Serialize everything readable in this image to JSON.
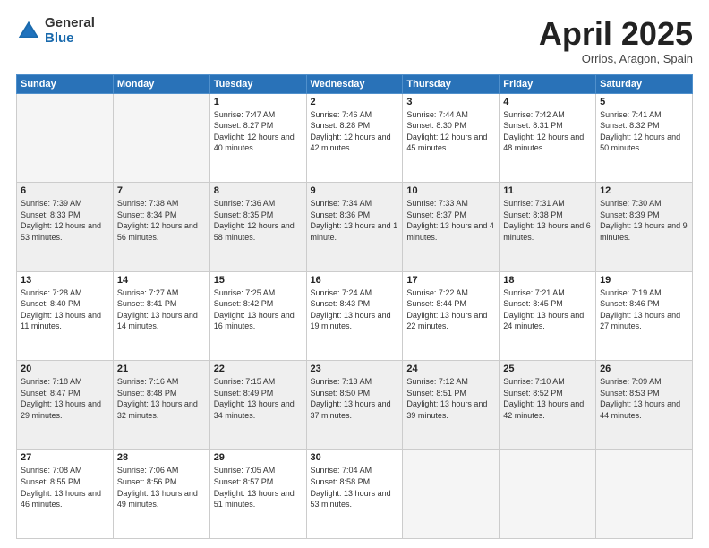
{
  "header": {
    "logo_general": "General",
    "logo_blue": "Blue",
    "month": "April 2025",
    "location": "Orrios, Aragon, Spain"
  },
  "days_of_week": [
    "Sunday",
    "Monday",
    "Tuesday",
    "Wednesday",
    "Thursday",
    "Friday",
    "Saturday"
  ],
  "weeks": [
    [
      {
        "num": "",
        "empty": true
      },
      {
        "num": "",
        "empty": true
      },
      {
        "num": "1",
        "sunrise": "7:47 AM",
        "sunset": "8:27 PM",
        "daylight": "12 hours and 40 minutes."
      },
      {
        "num": "2",
        "sunrise": "7:46 AM",
        "sunset": "8:28 PM",
        "daylight": "12 hours and 42 minutes."
      },
      {
        "num": "3",
        "sunrise": "7:44 AM",
        "sunset": "8:30 PM",
        "daylight": "12 hours and 45 minutes."
      },
      {
        "num": "4",
        "sunrise": "7:42 AM",
        "sunset": "8:31 PM",
        "daylight": "12 hours and 48 minutes."
      },
      {
        "num": "5",
        "sunrise": "7:41 AM",
        "sunset": "8:32 PM",
        "daylight": "12 hours and 50 minutes."
      }
    ],
    [
      {
        "num": "6",
        "sunrise": "7:39 AM",
        "sunset": "8:33 PM",
        "daylight": "12 hours and 53 minutes."
      },
      {
        "num": "7",
        "sunrise": "7:38 AM",
        "sunset": "8:34 PM",
        "daylight": "12 hours and 56 minutes."
      },
      {
        "num": "8",
        "sunrise": "7:36 AM",
        "sunset": "8:35 PM",
        "daylight": "12 hours and 58 minutes."
      },
      {
        "num": "9",
        "sunrise": "7:34 AM",
        "sunset": "8:36 PM",
        "daylight": "13 hours and 1 minute."
      },
      {
        "num": "10",
        "sunrise": "7:33 AM",
        "sunset": "8:37 PM",
        "daylight": "13 hours and 4 minutes."
      },
      {
        "num": "11",
        "sunrise": "7:31 AM",
        "sunset": "8:38 PM",
        "daylight": "13 hours and 6 minutes."
      },
      {
        "num": "12",
        "sunrise": "7:30 AM",
        "sunset": "8:39 PM",
        "daylight": "13 hours and 9 minutes."
      }
    ],
    [
      {
        "num": "13",
        "sunrise": "7:28 AM",
        "sunset": "8:40 PM",
        "daylight": "13 hours and 11 minutes."
      },
      {
        "num": "14",
        "sunrise": "7:27 AM",
        "sunset": "8:41 PM",
        "daylight": "13 hours and 14 minutes."
      },
      {
        "num": "15",
        "sunrise": "7:25 AM",
        "sunset": "8:42 PM",
        "daylight": "13 hours and 16 minutes."
      },
      {
        "num": "16",
        "sunrise": "7:24 AM",
        "sunset": "8:43 PM",
        "daylight": "13 hours and 19 minutes."
      },
      {
        "num": "17",
        "sunrise": "7:22 AM",
        "sunset": "8:44 PM",
        "daylight": "13 hours and 22 minutes."
      },
      {
        "num": "18",
        "sunrise": "7:21 AM",
        "sunset": "8:45 PM",
        "daylight": "13 hours and 24 minutes."
      },
      {
        "num": "19",
        "sunrise": "7:19 AM",
        "sunset": "8:46 PM",
        "daylight": "13 hours and 27 minutes."
      }
    ],
    [
      {
        "num": "20",
        "sunrise": "7:18 AM",
        "sunset": "8:47 PM",
        "daylight": "13 hours and 29 minutes."
      },
      {
        "num": "21",
        "sunrise": "7:16 AM",
        "sunset": "8:48 PM",
        "daylight": "13 hours and 32 minutes."
      },
      {
        "num": "22",
        "sunrise": "7:15 AM",
        "sunset": "8:49 PM",
        "daylight": "13 hours and 34 minutes."
      },
      {
        "num": "23",
        "sunrise": "7:13 AM",
        "sunset": "8:50 PM",
        "daylight": "13 hours and 37 minutes."
      },
      {
        "num": "24",
        "sunrise": "7:12 AM",
        "sunset": "8:51 PM",
        "daylight": "13 hours and 39 minutes."
      },
      {
        "num": "25",
        "sunrise": "7:10 AM",
        "sunset": "8:52 PM",
        "daylight": "13 hours and 42 minutes."
      },
      {
        "num": "26",
        "sunrise": "7:09 AM",
        "sunset": "8:53 PM",
        "daylight": "13 hours and 44 minutes."
      }
    ],
    [
      {
        "num": "27",
        "sunrise": "7:08 AM",
        "sunset": "8:55 PM",
        "daylight": "13 hours and 46 minutes."
      },
      {
        "num": "28",
        "sunrise": "7:06 AM",
        "sunset": "8:56 PM",
        "daylight": "13 hours and 49 minutes."
      },
      {
        "num": "29",
        "sunrise": "7:05 AM",
        "sunset": "8:57 PM",
        "daylight": "13 hours and 51 minutes."
      },
      {
        "num": "30",
        "sunrise": "7:04 AM",
        "sunset": "8:58 PM",
        "daylight": "13 hours and 53 minutes."
      },
      {
        "num": "",
        "empty": true
      },
      {
        "num": "",
        "empty": true
      },
      {
        "num": "",
        "empty": true
      }
    ]
  ]
}
